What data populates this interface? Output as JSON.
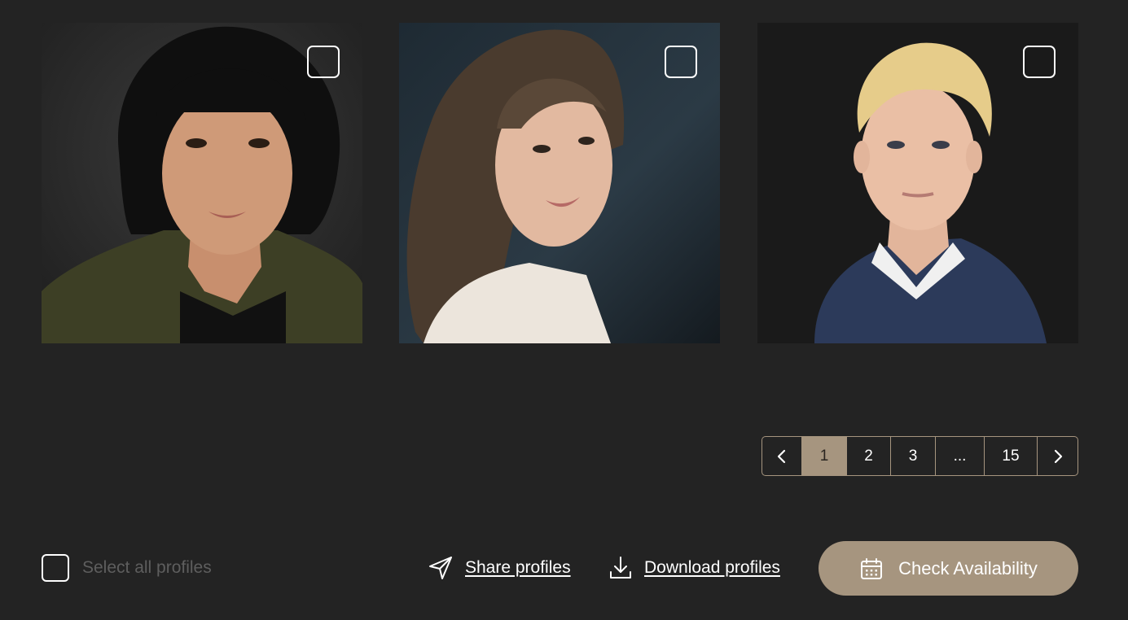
{
  "profiles": [
    {
      "id": "profile-1",
      "selected": false,
      "portrait": "woman with black bob haircut and bangs, olive cardigan"
    },
    {
      "id": "profile-2",
      "selected": false,
      "portrait": "woman with long brown hair looking over shoulder, cream top"
    },
    {
      "id": "profile-3",
      "selected": false,
      "portrait": "young man with blond hair, navy sweater over white collar"
    }
  ],
  "pagination": {
    "prev_icon": "chevron-left-icon",
    "pages": [
      "1",
      "2",
      "3",
      "...",
      "15"
    ],
    "current": "1",
    "next_icon": "chevron-right-icon"
  },
  "toolbar": {
    "select_all_label": "Select all profiles",
    "share_label": "Share profiles",
    "share_icon": "send-icon",
    "download_label": "Download profiles",
    "download_icon": "download-icon",
    "check_availability_label": "Check Availability",
    "check_availability_icon": "calendar-icon"
  },
  "colors": {
    "background": "#232323",
    "accent": "#a6957f",
    "muted_text": "#5e5e5e"
  }
}
